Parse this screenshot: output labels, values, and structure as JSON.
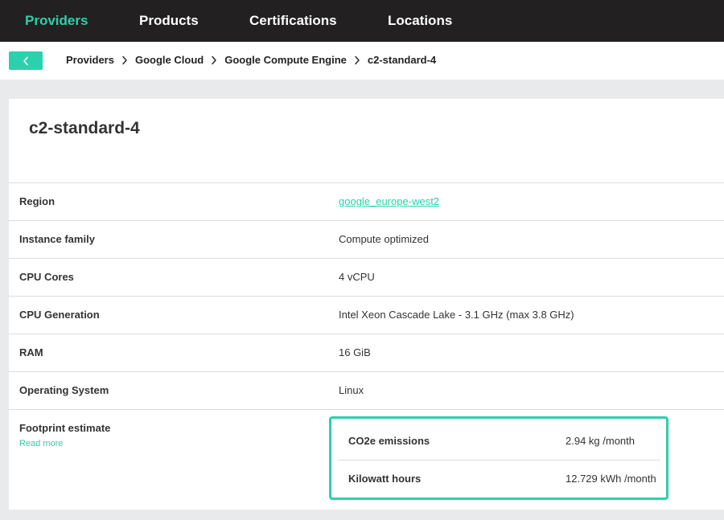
{
  "nav": {
    "items": [
      {
        "label": "Providers",
        "active": true
      },
      {
        "label": "Products",
        "active": false
      },
      {
        "label": "Certifications",
        "active": false
      },
      {
        "label": "Locations",
        "active": false
      }
    ]
  },
  "breadcrumb": {
    "back_icon": "chevron-left-icon",
    "items": [
      "Providers",
      "Google Cloud",
      "Google Compute Engine",
      "c2-standard-4"
    ],
    "separator_icon": "chevron-right-icon"
  },
  "page": {
    "title": "c2-standard-4"
  },
  "specs": [
    {
      "label": "Region",
      "value": "google_europe-west2"
    },
    {
      "label": "Instance family",
      "value": "Compute optimized"
    },
    {
      "label": "CPU Cores",
      "value": "4 vCPU"
    },
    {
      "label": "CPU Generation",
      "value": "Intel Xeon Cascade Lake - 3.1 GHz (max 3.8 GHz)"
    },
    {
      "label": "RAM",
      "value": "16 GiB"
    },
    {
      "label": "Operating System",
      "value": "Linux"
    }
  ],
  "footprint": {
    "label": "Footprint estimate",
    "read_more": "Read more",
    "rows": [
      {
        "label": "CO2e emissions",
        "value": "2.94 kg /month"
      },
      {
        "label": "Kilowatt hours",
        "value": "12.729 kWh /month"
      }
    ]
  },
  "colors": {
    "accent": "#2bd1ad",
    "nav_bg": "#222021",
    "page_bg": "#e9eaeb"
  }
}
